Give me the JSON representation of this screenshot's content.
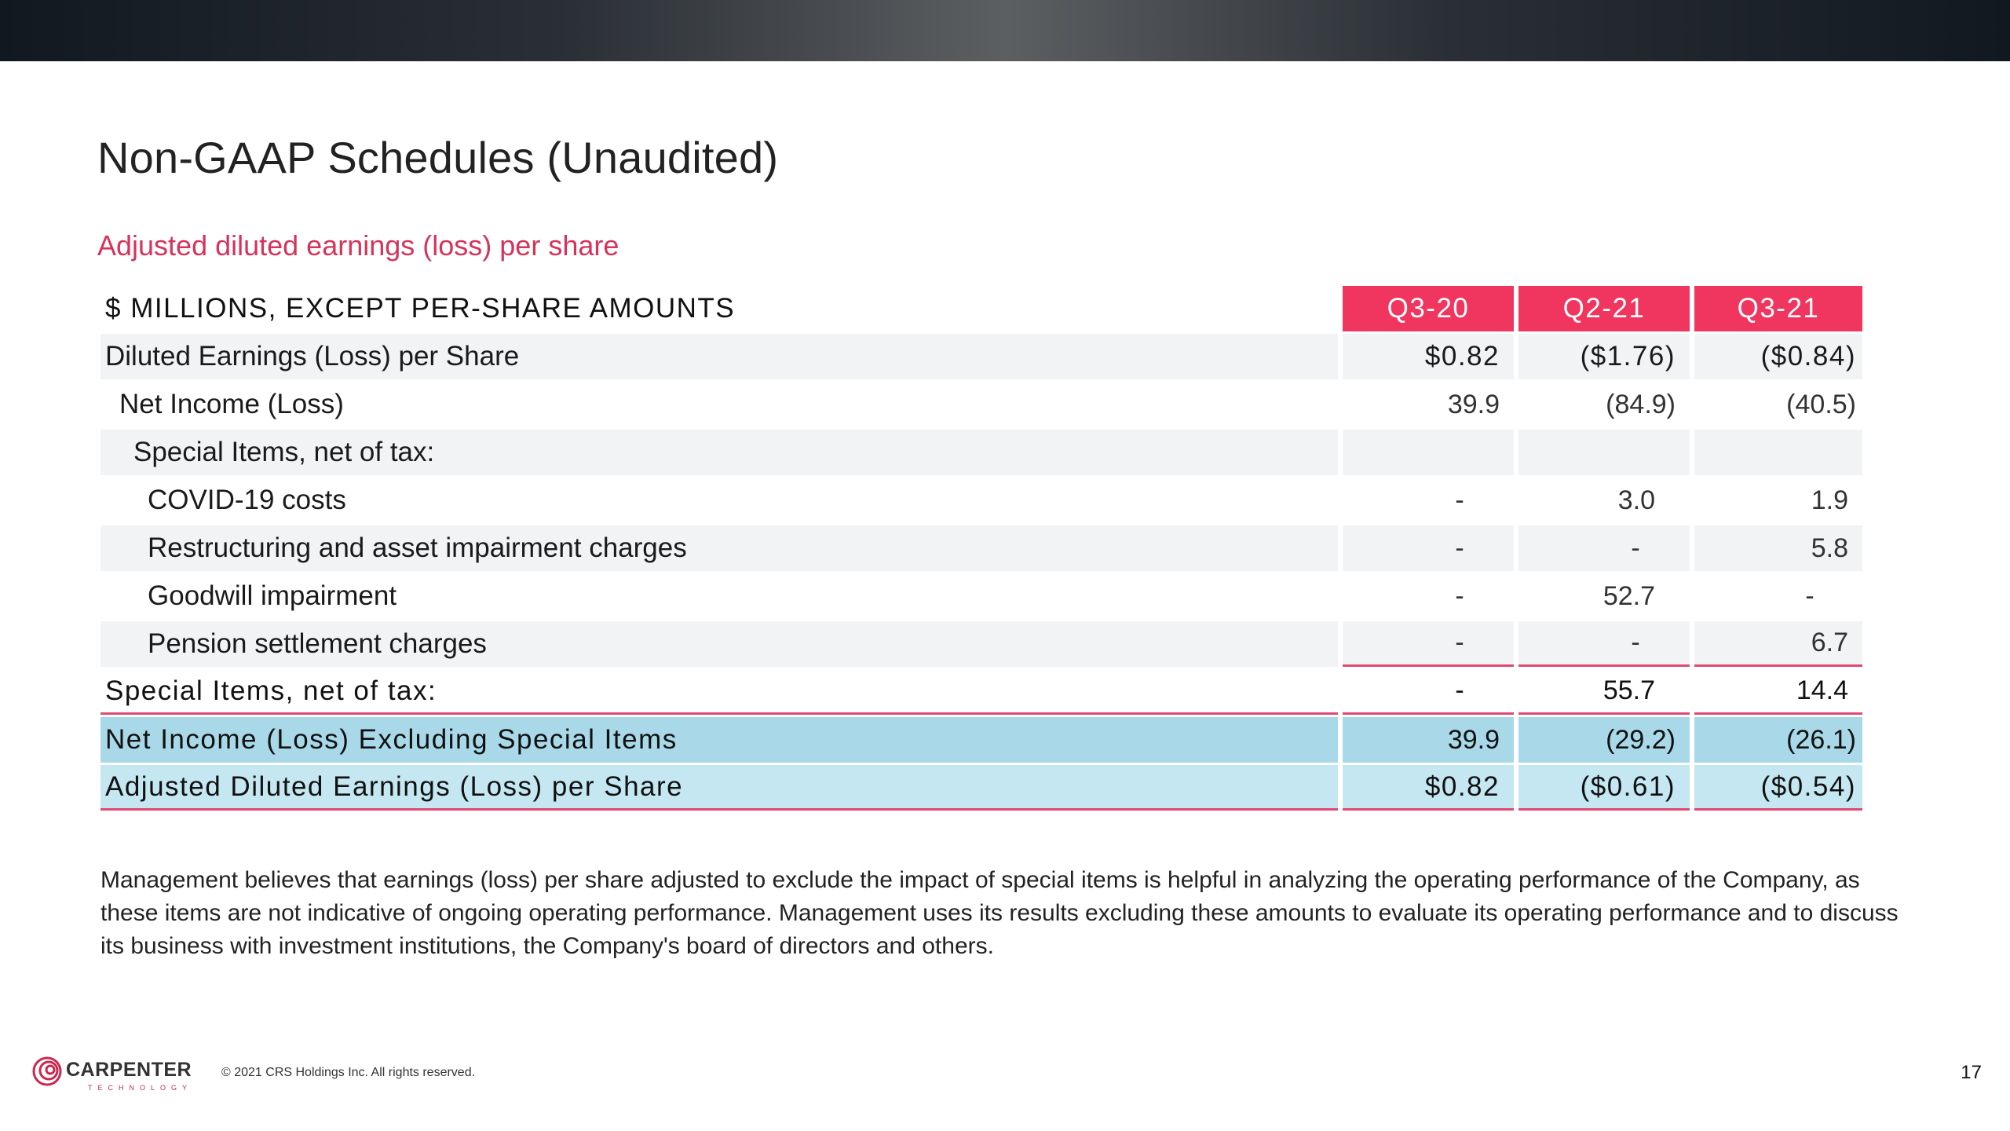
{
  "title": "Non-GAAP Schedules (Unaudited)",
  "subtitle": "Adjusted diluted earnings (loss) per share",
  "table": {
    "header": {
      "label": "$ MILLIONS, EXCEPT PER-SHARE AMOUNTS",
      "columns": [
        "Q3-20",
        "Q2-21",
        "Q3-21"
      ]
    },
    "rows": [
      {
        "label": "Diluted Earnings (Loss) per Share",
        "values": [
          "$0.82",
          "($1.76)",
          "($0.84)"
        ]
      },
      {
        "label": "Net Income (Loss)",
        "values": [
          "39.9",
          "(84.9)",
          "(40.5)"
        ]
      },
      {
        "label": "Special Items, net of tax:",
        "values": [
          "",
          "",
          ""
        ]
      },
      {
        "label": "COVID-19 costs",
        "values": [
          "-",
          "3.0",
          "1.9"
        ]
      },
      {
        "label": "Restructuring and asset impairment charges",
        "values": [
          "-",
          "-",
          "5.8"
        ]
      },
      {
        "label": "Goodwill impairment",
        "values": [
          "-",
          "52.7",
          "-"
        ]
      },
      {
        "label": "Pension settlement charges",
        "values": [
          "-",
          "-",
          "6.7"
        ]
      },
      {
        "label": "Special Items, net of tax:",
        "values": [
          "-",
          "55.7",
          "14.4"
        ]
      },
      {
        "label": "Net Income (Loss) Excluding Special Items",
        "values": [
          "39.9",
          "(29.2)",
          "(26.1)"
        ]
      },
      {
        "label": "Adjusted Diluted Earnings (Loss) per Share",
        "values": [
          "$0.82",
          "($0.61)",
          "($0.54)"
        ]
      }
    ]
  },
  "note": "Management believes that earnings (loss) per share adjusted to exclude the impact of special items is helpful in analyzing the operating performance of the Company, as these items are not indicative of ongoing operating performance. Management uses its results excluding these amounts to evaluate its operating performance and to discuss its business with investment institutions, the Company's board of directors and others.",
  "footer": {
    "logo_text": "CARPENTER",
    "logo_sub": "TECHNOLOGY",
    "copyright": "© 2021 CRS Holdings Inc. All rights reserved.",
    "page_number": "17"
  },
  "colors": {
    "accent_pink": "#f0355f",
    "subtitle_pink": "#d6335b",
    "highlight_blue": "#a9d9e9",
    "highlight_blue_light": "#c5e7f1"
  }
}
